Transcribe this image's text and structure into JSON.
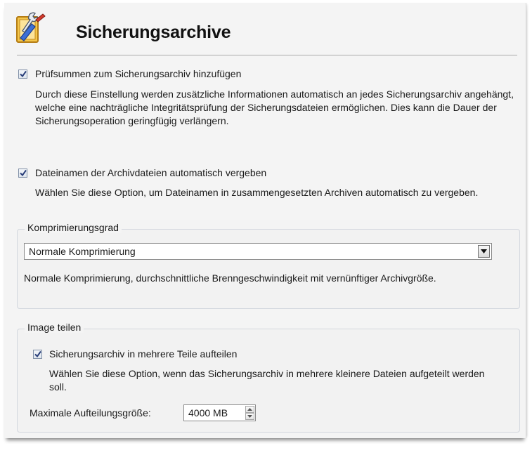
{
  "header": {
    "title": "Sicherungsarchive",
    "icon": "settings-brush-wrench-icon"
  },
  "checksum": {
    "label": "Prüfsummen zum Sicherungsarchiv hinzufügen",
    "checked": true,
    "description": "Durch diese Einstellung werden zusätzliche Informationen automatisch an jedes Sicherungsarchiv angehängt, welche eine nachträgliche Integritätsprüfung der Sicherungsdateien ermöglichen. Dies kann die Dauer der Sicherungsoperation geringfügig verlängern."
  },
  "auto_names": {
    "label": "Dateinamen der Archivdateien automatisch vergeben",
    "checked": true,
    "description": "Wählen Sie diese Option, um Dateinamen in zusammengesetzten Archiven automatisch zu vergeben."
  },
  "compression": {
    "group_label": "Komprimierungsgrad",
    "selected": "Normale Komprimierung",
    "description": "Normale Komprimierung, durchschnittliche Brenngeschwindigkeit mit vernünftiger Archivgröße."
  },
  "split": {
    "group_label": "Image teilen",
    "checkbox_label": "Sicherungsarchiv in mehrere Teile aufteilen",
    "checked": true,
    "description": "Wählen Sie diese Option, wenn das Sicherungsarchiv in mehrere kleinere Dateien aufgeteilt werden soll.",
    "max_size_label": "Maximale Aufteilungsgröße:",
    "max_size_value": "4000 MB"
  }
}
